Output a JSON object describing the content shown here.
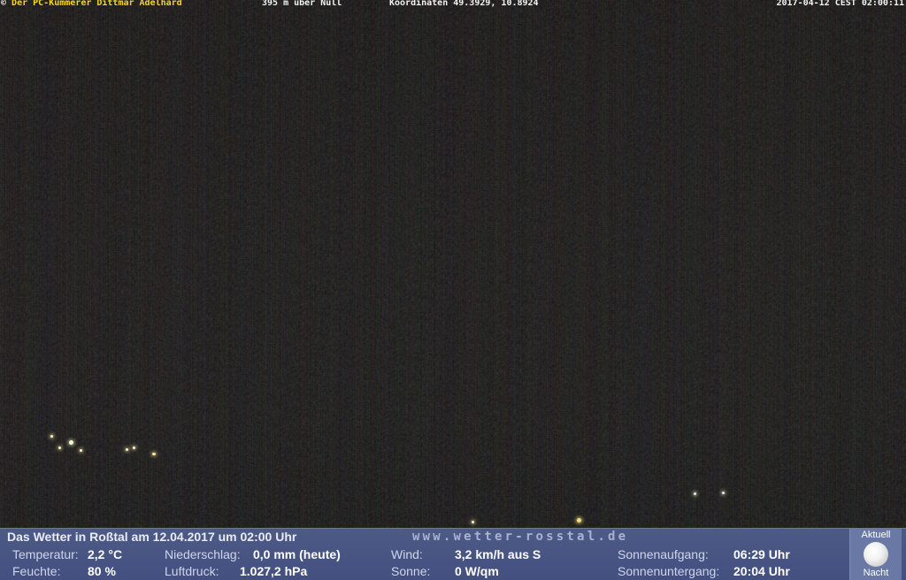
{
  "overlay": {
    "copyright": "© ",
    "owner": "Der PC-Kümmerer Dittmar Adelhard",
    "altitude": "395 m über Null",
    "coordinates": "Koordinaten 49.3929, 10.8924",
    "timestamp": "2017-04-12 CEST 02:00:11"
  },
  "panel": {
    "headline": "Das Wetter in Roßtal am 12.04.2017 um 02:00 Uhr",
    "url": "www.wetter-rosstal.de",
    "temperature": {
      "label": "Temperatur:",
      "value": "2,2 °C"
    },
    "humidity": {
      "label": "Feuchte:",
      "value": "80 %"
    },
    "precipitation": {
      "label": "Niederschlag:",
      "value": "0,0 mm (heute)"
    },
    "pressure": {
      "label": "Luftdruck:",
      "value": "1.027,2 hPa"
    },
    "wind": {
      "label": "Wind:",
      "value": "3,2 km/h aus S"
    },
    "sun": {
      "label": "Sonne:",
      "value": "0 W/qm"
    },
    "sunrise": {
      "label": "Sonnenaufgang:",
      "value": "06:29 Uhr"
    },
    "sunset": {
      "label": "Sonnenuntergang:",
      "value": "20:04 Uhr"
    },
    "phase": {
      "top_label": "Aktuell",
      "bottom_label": "Nacht",
      "icon": "moon-icon"
    }
  },
  "colors": {
    "owner_text": "#f5d51c",
    "panel_background": "#4d5a86",
    "phase_box": "#6a78a5"
  }
}
